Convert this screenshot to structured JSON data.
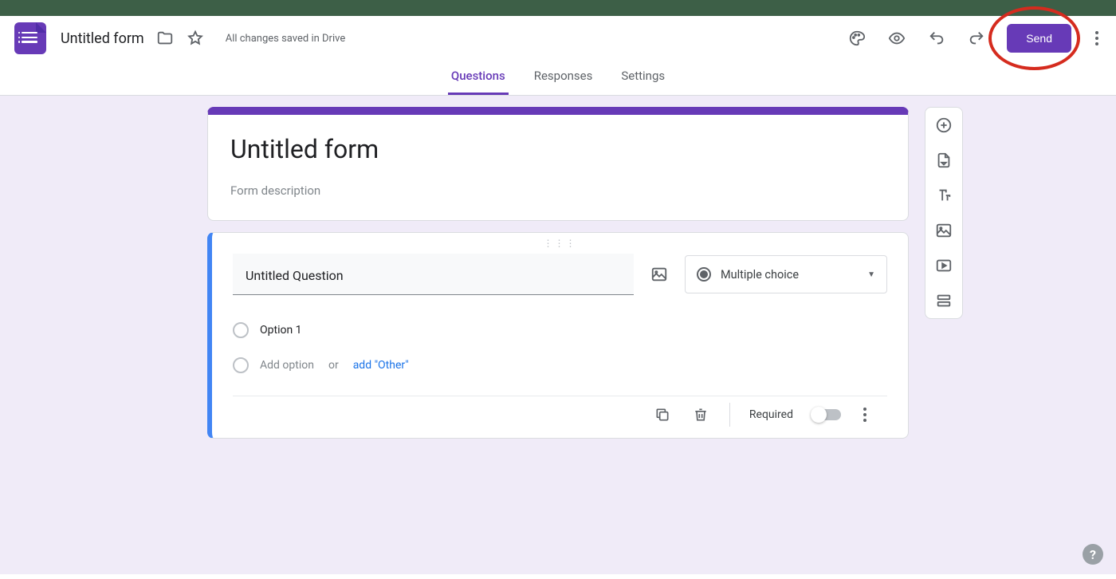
{
  "header": {
    "doc_title": "Untitled form",
    "save_status": "All changes saved in Drive",
    "send_label": "Send"
  },
  "tabs": {
    "questions": "Questions",
    "responses": "Responses",
    "settings": "Settings",
    "active": "questions"
  },
  "form": {
    "title": "Untitled form",
    "description_placeholder": "Form description"
  },
  "question": {
    "title": "Untitled Question",
    "type_label": "Multiple choice",
    "options": [
      {
        "label": "Option 1"
      }
    ],
    "add_option_label": "Add option",
    "or_label": "or",
    "add_other_label": "add \"Other\"",
    "required_label": "Required",
    "required": false
  },
  "side_toolbar": {
    "add_question": "add-question",
    "import_questions": "import-questions",
    "add_title": "add-title",
    "add_image": "add-image",
    "add_video": "add-video",
    "add_section": "add-section"
  },
  "icons": {
    "folder": "folder-icon",
    "star": "star-icon",
    "palette": "palette-icon",
    "preview": "preview-icon",
    "undo": "undo-icon",
    "redo": "redo-icon",
    "more": "more-icon"
  },
  "accent_color": "#673ab7",
  "highlight": {
    "target": "send-button",
    "color": "#d52b1e"
  },
  "help_label": "?"
}
